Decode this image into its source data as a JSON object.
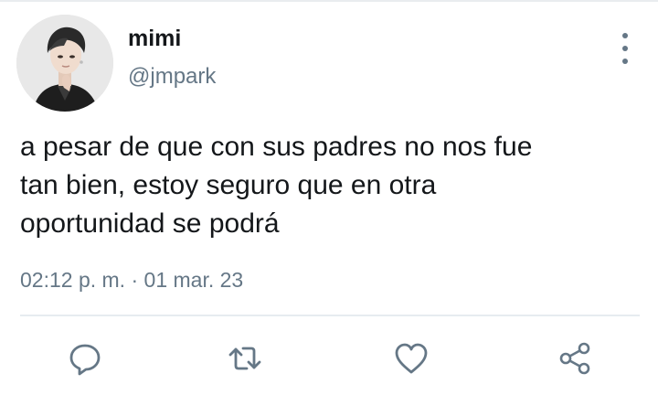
{
  "tweet": {
    "user": {
      "display_name": "mimi",
      "handle": "@jmpark",
      "avatar_icon": "profile-photo"
    },
    "text": "a pesar de que con sus padres no nos fue\ntan bien, estoy seguro que en otra\noportunidad se podrá",
    "time": "02:12 p. m.",
    "separator": "·",
    "date": "01 mar. 23"
  },
  "actions": [
    {
      "name": "reply",
      "icon": "reply-icon"
    },
    {
      "name": "retweet",
      "icon": "retweet-icon"
    },
    {
      "name": "like",
      "icon": "heart-icon"
    },
    {
      "name": "share",
      "icon": "share-icon"
    }
  ],
  "colors": {
    "primary_text": "#14171a",
    "secondary_text": "#657786",
    "icon": "#657786",
    "divider": "#e6ecf0"
  }
}
